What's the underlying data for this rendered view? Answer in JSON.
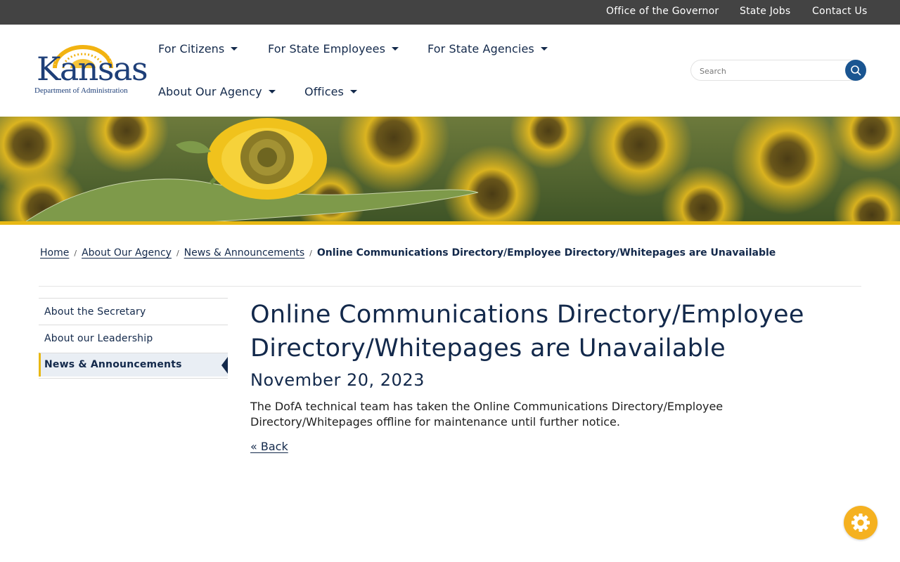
{
  "utility_bar": {
    "links": [
      "Office of the Governor",
      "State Jobs",
      "Contact Us"
    ]
  },
  "logo": {
    "arc_text": "AD ASTRA PER ASPERA",
    "wordmark": "Kansas",
    "subtitle": "Department of Administration"
  },
  "nav": {
    "items": [
      {
        "label": "For Citizens"
      },
      {
        "label": "For State Employees"
      },
      {
        "label": "For State Agencies"
      },
      {
        "label": "About Our Agency"
      },
      {
        "label": "Offices"
      }
    ]
  },
  "search": {
    "placeholder": "Search",
    "value": ""
  },
  "breadcrumb": {
    "items": [
      "Home",
      "About Our Agency",
      "News & Announcements"
    ],
    "separator": "/",
    "current": "Online Communications Directory/Employee Directory/Whitepages are Unavailable"
  },
  "sidebar": {
    "items": [
      {
        "label": "About the Secretary",
        "active": false
      },
      {
        "label": "About our Leadership",
        "active": false
      },
      {
        "label": "News & Announcements",
        "active": true
      }
    ]
  },
  "article": {
    "title": "Online Communications Directory/Employee Directory/Whitepages are Unavailable",
    "date": "November 20, 2023",
    "body": "The DofA technical team has taken the Online Communications Directory/Employee Directory/Whitepages offline for maintenance until further notice.",
    "back_label": "« Back"
  },
  "icons": {
    "search": "search-icon",
    "settings": "gear-icon",
    "dropdown": "caret-down-icon"
  },
  "colors": {
    "utility_bar": "#434343",
    "navy": "#13294b",
    "accent_gold": "#e8b814",
    "search_button": "#1a5591",
    "settings_button": "#f5b120"
  }
}
